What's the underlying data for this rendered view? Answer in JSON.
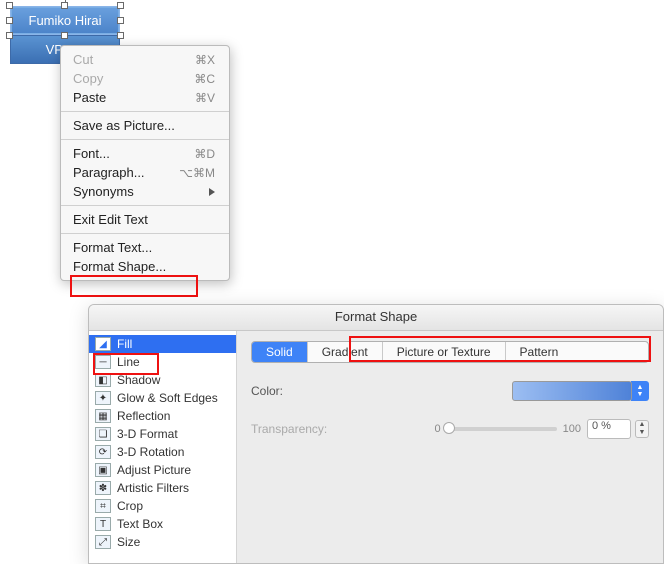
{
  "shape": {
    "title_text": "Fumiko Hirai",
    "subtitle_text": "VP Ma"
  },
  "context_menu": {
    "items": [
      {
        "label": "Cut",
        "shortcut": "⌘X",
        "disabled": true
      },
      {
        "label": "Copy",
        "shortcut": "⌘C",
        "disabled": true
      },
      {
        "label": "Paste",
        "shortcut": "⌘V",
        "disabled": false
      },
      {
        "separator": true
      },
      {
        "label": "Save as Picture...",
        "disabled": false
      },
      {
        "separator": true
      },
      {
        "label": "Font...",
        "shortcut": "⌘D"
      },
      {
        "label": "Paragraph...",
        "shortcut": "⌥⌘M"
      },
      {
        "label": "Synonyms",
        "submenu": true
      },
      {
        "separator": true
      },
      {
        "label": "Exit Edit Text"
      },
      {
        "separator": true
      },
      {
        "label": "Format Text..."
      },
      {
        "label": "Format Shape..."
      }
    ]
  },
  "dialog": {
    "title": "Format Shape",
    "sidebar": [
      {
        "label": "Fill",
        "selected": true
      },
      {
        "label": "Line"
      },
      {
        "label": "Shadow"
      },
      {
        "label": "Glow & Soft Edges"
      },
      {
        "label": "Reflection"
      },
      {
        "label": "3-D Format"
      },
      {
        "label": "3-D Rotation"
      },
      {
        "label": "Adjust Picture"
      },
      {
        "label": "Artistic Filters"
      },
      {
        "label": "Crop"
      },
      {
        "label": "Text Box"
      },
      {
        "label": "Size"
      }
    ],
    "tabs": [
      {
        "label": "Solid",
        "selected": true
      },
      {
        "label": "Gradient"
      },
      {
        "label": "Picture or Texture"
      },
      {
        "label": "Pattern"
      }
    ],
    "color_label": "Color:",
    "transparency_label": "Transparency:",
    "transparency_min": "0",
    "transparency_max": "100",
    "transparency_value": "0 %"
  }
}
